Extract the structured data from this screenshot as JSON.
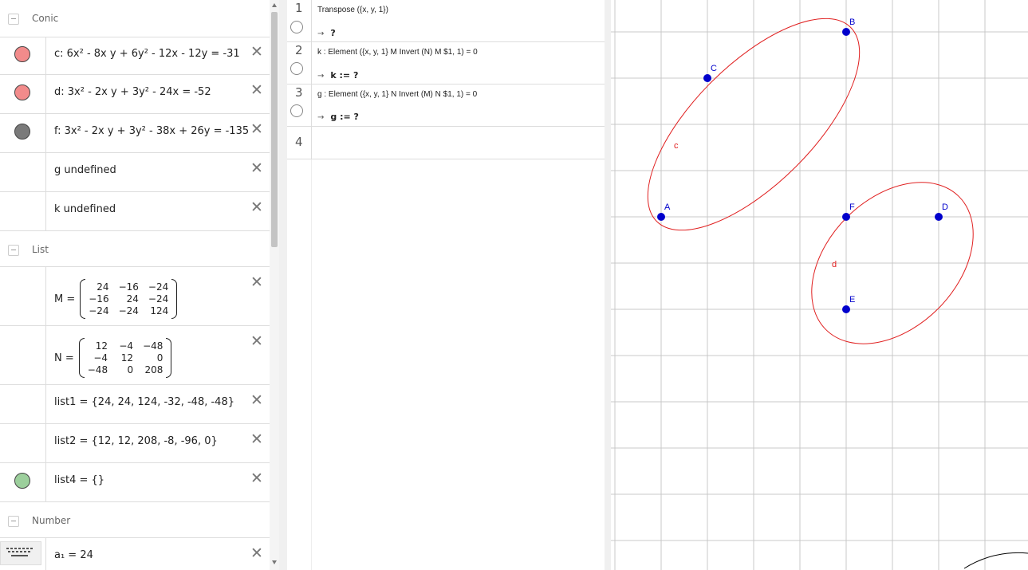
{
  "algebra": {
    "groups": [
      {
        "title": "Conic"
      },
      {
        "title": "List"
      },
      {
        "title": "Number"
      }
    ],
    "conic_items": [
      {
        "expr": "c: 6x² - 8x y + 6y² - 12x - 12y = -31",
        "color": "#f28b8b"
      },
      {
        "expr": "d: 3x² - 2x y + 3y² - 24x = -52",
        "color": "#f28b8b"
      },
      {
        "expr": "f: 3x² - 2x y + 3y² - 38x + 26y = -135",
        "color": "#7a7a7a"
      },
      {
        "expr": "g undefined"
      },
      {
        "expr": "k undefined"
      }
    ],
    "matrix_M": {
      "label": "M =",
      "cells": [
        "24",
        "−16",
        "−24",
        "−16",
        "24",
        "−24",
        "−24",
        "−24",
        "124"
      ]
    },
    "matrix_N": {
      "label": "N =",
      "cells": [
        "12",
        "−4",
        "−48",
        "−4",
        "12",
        "0",
        "−48",
        "0",
        "208"
      ]
    },
    "list_items": [
      {
        "expr": "list1 = {24, 24, 124, -32, -48, -48}"
      },
      {
        "expr": "list2 = {12, 12, 208, -8, -96, 0}"
      },
      {
        "expr": "list4 = {}",
        "color": "#9ccf9c"
      }
    ],
    "number_items": [
      {
        "expr": "a₁ = 24"
      }
    ]
  },
  "cas": {
    "rows": [
      {
        "num": "1",
        "input": "Transpose ({x, y, 1})",
        "output": "?"
      },
      {
        "num": "2",
        "input": "k : Element ({x, y, 1}  M Invert (N)  M $1, 1) = 0",
        "output": "k := ?"
      },
      {
        "num": "3",
        "input": "g : Element ({x, y, 1}  N Invert (M)  N $1, 1) = 0",
        "output": "g := ?"
      },
      {
        "num": "4"
      }
    ],
    "arrow": "→"
  },
  "graphics": {
    "curve_color": "#e02020",
    "point_color": "#0000cc",
    "grid_color": "#c8c8c8",
    "points": [
      {
        "label": "A"
      },
      {
        "label": "B"
      },
      {
        "label": "C"
      },
      {
        "label": "D"
      },
      {
        "label": "E"
      },
      {
        "label": "F"
      }
    ],
    "curve_labels": [
      {
        "label": "c"
      },
      {
        "label": "d"
      }
    ]
  },
  "close_glyph": "✕"
}
